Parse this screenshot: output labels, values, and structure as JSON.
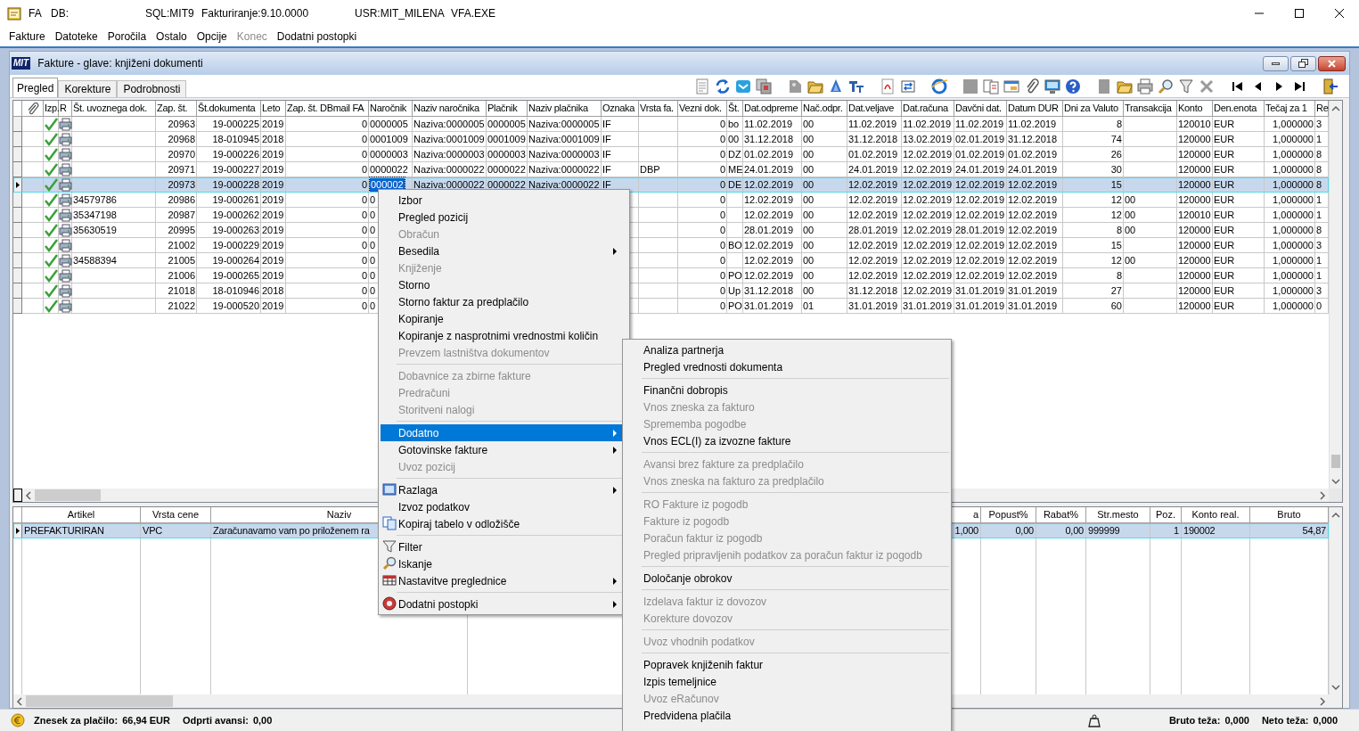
{
  "app_bar": {
    "texts": [
      "FA",
      "DB:",
      "SQL:MIT9",
      "Fakturiranje:9.10.0000",
      "USR:MIT_MILENA",
      "VFA.EXE"
    ]
  },
  "menu_bar": [
    {
      "label": "Fakture",
      "disabled": false
    },
    {
      "label": "Datoteke",
      "disabled": false
    },
    {
      "label": "Poročila",
      "disabled": false
    },
    {
      "label": "Ostalo",
      "disabled": false
    },
    {
      "label": "Opcije",
      "disabled": false
    },
    {
      "label": "Konec",
      "disabled": true
    },
    {
      "label": "Dodatni postopki",
      "disabled": false
    }
  ],
  "child_window": {
    "logo": "MIT",
    "title": "Fakture - glave: knjiženi dokumenti"
  },
  "tabs": [
    {
      "label": "Pregled",
      "selected": true
    },
    {
      "label": "Korekture",
      "selected": false
    },
    {
      "label": "Podrobnosti",
      "selected": false
    }
  ],
  "table": {
    "columns": [
      "Izp.",
      "R",
      "Št. uvoznega dok.",
      "Zap. št.",
      "Št.dokumenta",
      "Leto",
      "Zap. št. DBmail FA",
      "Naročnik",
      "Naziv naročnika",
      "Plačnik",
      "Naziv plačnika",
      "Oznaka",
      "Vrsta fa.",
      "Vezni dok.",
      "Št.",
      "Dat.odpreme",
      "Nač.odpr.",
      "Dat.veljave",
      "Dat.računa",
      "Davčni dat.",
      "Datum DUR",
      "Dni za Valuto",
      "Transakcija",
      "Konto",
      "Den.enota",
      "Tečaj za 1",
      "Re"
    ],
    "rows": [
      {
        "selected": false,
        "cells": [
          "",
          "",
          "",
          "20963",
          "19-000225",
          "2019",
          "0",
          "0000005",
          "Naziva:0000005",
          "0000005",
          "Naziva:0000005",
          "IF",
          "",
          "0",
          "bo",
          "11.02.2019",
          "00",
          "11.02.2019",
          "11.02.2019",
          "11.02.2019",
          "11.02.2019",
          "8",
          "",
          "120010",
          "EUR",
          "1,000000",
          "3"
        ]
      },
      {
        "selected": false,
        "cells": [
          "",
          "",
          "",
          "20968",
          "18-010945",
          "2018",
          "0",
          "0001009",
          "Naziva:0001009",
          "0001009",
          "Naziva:0001009",
          "IF",
          "",
          "0",
          "00",
          "31.12.2018",
          "00",
          "31.12.2018",
          "13.02.2019",
          "02.01.2019",
          "31.12.2018",
          "74",
          "",
          "120000",
          "EUR",
          "1,000000",
          "1"
        ]
      },
      {
        "selected": false,
        "cells": [
          "",
          "",
          "",
          "20970",
          "19-000226",
          "2019",
          "0",
          "0000003",
          "Naziva:0000003",
          "0000003",
          "Naziva:0000003",
          "IF",
          "",
          "0",
          "DZ",
          "01.02.2019",
          "00",
          "01.02.2019",
          "12.02.2019",
          "01.02.2019",
          "01.02.2019",
          "26",
          "",
          "120000",
          "EUR",
          "1,000000",
          "8"
        ]
      },
      {
        "selected": false,
        "cells": [
          "",
          "",
          "",
          "20971",
          "19-000227",
          "2019",
          "0",
          "0000022",
          "Naziva:0000022",
          "0000022",
          "Naziva:0000022",
          "IF",
          "DBP",
          "0",
          "ME",
          "24.01.2019",
          "00",
          "24.01.2019",
          "12.02.2019",
          "24.01.2019",
          "24.01.2019",
          "30",
          "",
          "120000",
          "EUR",
          "1,000000",
          "8"
        ]
      },
      {
        "selected": true,
        "cells": [
          "",
          "",
          "",
          "20973",
          "19-000228",
          "2019",
          "0",
          {
            "text": "000002",
            "focused": true
          },
          "Naziva:0000022",
          "0000022",
          "Naziva:0000022",
          "IF",
          "",
          "0",
          "DE",
          "12.02.2019",
          "00",
          "12.02.2019",
          "12.02.2019",
          "12.02.2019",
          "12.02.2019",
          "15",
          "",
          "120000",
          "EUR",
          "1,000000",
          "8"
        ]
      },
      {
        "selected": false,
        "cells": [
          "",
          "",
          "34579786",
          "20986",
          "19-000261",
          "2019",
          "0",
          "0",
          "",
          "",
          "",
          "",
          "",
          "0",
          "",
          "12.02.2019",
          "00",
          "12.02.2019",
          "12.02.2019",
          "12.02.2019",
          "12.02.2019",
          "12",
          "00",
          "120000",
          "EUR",
          "1,000000",
          "1"
        ]
      },
      {
        "selected": false,
        "cells": [
          "",
          "",
          "35347198",
          "20987",
          "19-000262",
          "2019",
          "0",
          "0",
          "",
          "",
          "",
          "",
          "",
          "0",
          "",
          "12.02.2019",
          "00",
          "12.02.2019",
          "12.02.2019",
          "12.02.2019",
          "12.02.2019",
          "12",
          "00",
          "120010",
          "EUR",
          "1,000000",
          "1"
        ]
      },
      {
        "selected": false,
        "cells": [
          "",
          "",
          "35630519",
          "20995",
          "19-000263",
          "2019",
          "0",
          "0",
          "",
          "",
          "",
          "",
          "",
          "0",
          "",
          "28.01.2019",
          "00",
          "28.01.2019",
          "12.02.2019",
          "28.01.2019",
          "12.02.2019",
          "8",
          "00",
          "120000",
          "EUR",
          "1,000000",
          "8"
        ]
      },
      {
        "selected": false,
        "cells": [
          "",
          "",
          "",
          "21002",
          "19-000229",
          "2019",
          "0",
          "0",
          "",
          "",
          "",
          "",
          "",
          "0",
          "BO",
          "12.02.2019",
          "00",
          "12.02.2019",
          "12.02.2019",
          "12.02.2019",
          "12.02.2019",
          "15",
          "",
          "120000",
          "EUR",
          "1,000000",
          "3"
        ]
      },
      {
        "selected": false,
        "cells": [
          "",
          "",
          "34588394",
          "21005",
          "19-000264",
          "2019",
          "0",
          "0",
          "",
          "",
          "",
          "",
          "",
          "0",
          "",
          "12.02.2019",
          "00",
          "12.02.2019",
          "12.02.2019",
          "12.02.2019",
          "12.02.2019",
          "12",
          "00",
          "120000",
          "EUR",
          "1,000000",
          "1"
        ]
      },
      {
        "selected": false,
        "cells": [
          "",
          "",
          "",
          "21006",
          "19-000265",
          "2019",
          "0",
          "0",
          "",
          "",
          "",
          "",
          "",
          "0",
          "PO",
          "12.02.2019",
          "00",
          "12.02.2019",
          "12.02.2019",
          "12.02.2019",
          "12.02.2019",
          "8",
          "",
          "120000",
          "EUR",
          "1,000000",
          "1"
        ]
      },
      {
        "selected": false,
        "cells": [
          "",
          "",
          "",
          "21018",
          "18-010946",
          "2018",
          "0",
          "0",
          "",
          "",
          "",
          "",
          "",
          "0",
          "Up",
          "31.12.2018",
          "00",
          "31.12.2018",
          "12.02.2019",
          "31.01.2019",
          "31.01.2019",
          "27",
          "",
          "120000",
          "EUR",
          "1,000000",
          "3"
        ]
      },
      {
        "selected": false,
        "cells": [
          "",
          "",
          "",
          "21022",
          "19-000520",
          "2019",
          "0",
          "0",
          "",
          "",
          "",
          "",
          "",
          "0",
          "PO",
          "31.01.2019",
          "01",
          "31.01.2019",
          "31.01.2019",
          "31.01.2019",
          "31.01.2019",
          "60",
          "",
          "120000",
          "EUR",
          "1,000000",
          "0"
        ]
      }
    ]
  },
  "detail_table": {
    "columns": [
      "Artikel",
      "Vrsta cene",
      "Naziv",
      "a",
      "Popust%",
      "Rabat%",
      "Str.mesto",
      "Poz.",
      "Konto real.",
      "Bruto"
    ],
    "rows": [
      {
        "selected": true,
        "cells": [
          "PREFAKTURIRAN",
          "VPC",
          "Zaračunavamo vam po priloženem ra",
          "1,000",
          "0,00",
          "0,00",
          "999999",
          "1",
          "190002",
          "54,87"
        ]
      }
    ]
  },
  "context_menu": {
    "items": [
      {
        "kind": "item",
        "label": "Izbor",
        "disabled": false,
        "has_submenu": false,
        "highlighted": false
      },
      {
        "kind": "item",
        "label": "Pregled pozicij",
        "disabled": false,
        "has_submenu": false,
        "highlighted": false
      },
      {
        "kind": "item",
        "label": "Obračun",
        "disabled": true,
        "has_submenu": false,
        "highlighted": false
      },
      {
        "kind": "item",
        "label": "Besedila",
        "disabled": false,
        "has_submenu": true,
        "highlighted": false
      },
      {
        "kind": "item",
        "label": "Knjiženje",
        "disabled": true,
        "has_submenu": false,
        "highlighted": false
      },
      {
        "kind": "item",
        "label": "Storno",
        "disabled": false,
        "has_submenu": false,
        "highlighted": false
      },
      {
        "kind": "item",
        "label": "Storno faktur za predplačilo",
        "disabled": false,
        "has_submenu": false,
        "highlighted": false
      },
      {
        "kind": "item",
        "label": "Kopiranje",
        "disabled": false,
        "has_submenu": false,
        "highlighted": false
      },
      {
        "kind": "item",
        "label": "Kopiranje z nasprotnimi vrednostmi količin",
        "disabled": false,
        "has_submenu": false,
        "highlighted": false
      },
      {
        "kind": "item",
        "label": "Prevzem lastništva dokumentov",
        "disabled": true,
        "has_submenu": false,
        "highlighted": false
      },
      {
        "kind": "separator"
      },
      {
        "kind": "item",
        "label": "Dobavnice za zbirne fakture",
        "disabled": true,
        "has_submenu": false,
        "highlighted": false
      },
      {
        "kind": "item",
        "label": "Predračuni",
        "disabled": true,
        "has_submenu": false,
        "highlighted": false
      },
      {
        "kind": "item",
        "label": "Storitveni nalogi",
        "disabled": true,
        "has_submenu": false,
        "highlighted": false
      },
      {
        "kind": "separator"
      },
      {
        "kind": "item",
        "label": "Dodatno",
        "disabled": false,
        "has_submenu": true,
        "highlighted": true
      },
      {
        "kind": "item",
        "label": "Gotovinske fakture",
        "disabled": false,
        "has_submenu": true,
        "highlighted": false
      },
      {
        "kind": "item",
        "label": "Uvoz pozicij",
        "disabled": true,
        "has_submenu": false,
        "highlighted": false
      },
      {
        "kind": "separator"
      },
      {
        "kind": "item",
        "label": "Razlaga",
        "disabled": false,
        "has_submenu": true,
        "highlighted": false
      },
      {
        "kind": "item",
        "label": "Izvoz podatkov",
        "disabled": false,
        "has_submenu": false,
        "highlighted": false
      },
      {
        "kind": "item",
        "label": "Kopiraj tabelo v odložišče",
        "disabled": false,
        "has_submenu": false,
        "highlighted": false
      },
      {
        "kind": "separator"
      },
      {
        "kind": "item",
        "label": "Filter",
        "disabled": false,
        "has_submenu": false,
        "highlighted": false
      },
      {
        "kind": "item",
        "label": "Iskanje",
        "disabled": false,
        "has_submenu": false,
        "highlighted": false
      },
      {
        "kind": "item",
        "label": "Nastavitve preglednice",
        "disabled": false,
        "has_submenu": true,
        "highlighted": false
      },
      {
        "kind": "separator"
      },
      {
        "kind": "item",
        "label": "Dodatni postopki",
        "disabled": false,
        "has_submenu": true,
        "highlighted": false
      }
    ]
  },
  "submenu": {
    "items": [
      {
        "kind": "item",
        "label": "Analiza partnerja",
        "disabled": false
      },
      {
        "kind": "item",
        "label": "Pregled vrednosti dokumenta",
        "disabled": false
      },
      {
        "kind": "separator"
      },
      {
        "kind": "item",
        "label": "Finančni dobropis",
        "disabled": false
      },
      {
        "kind": "item",
        "label": "Vnos zneska za fakturo",
        "disabled": true
      },
      {
        "kind": "item",
        "label": "Sprememba pogodbe",
        "disabled": true
      },
      {
        "kind": "item",
        "label": "Vnos ECL(I) za izvozne fakture",
        "disabled": false
      },
      {
        "kind": "separator"
      },
      {
        "kind": "item",
        "label": "Avansi brez fakture za predplačilo",
        "disabled": true
      },
      {
        "kind": "item",
        "label": "Vnos zneska na fakturo za predplačilo",
        "disabled": true
      },
      {
        "kind": "separator"
      },
      {
        "kind": "item",
        "label": "RO Fakture iz pogodb",
        "disabled": true
      },
      {
        "kind": "item",
        "label": "Fakture iz pogodb",
        "disabled": true
      },
      {
        "kind": "item",
        "label": "Poračun faktur iz pogodb",
        "disabled": true
      },
      {
        "kind": "item",
        "label": "Pregled pripravljenih podatkov za poračun faktur iz pogodb",
        "disabled": true
      },
      {
        "kind": "separator"
      },
      {
        "kind": "item",
        "label": "Določanje obrokov",
        "disabled": false
      },
      {
        "kind": "separator"
      },
      {
        "kind": "item",
        "label": "Izdelava faktur iz dovozov",
        "disabled": true
      },
      {
        "kind": "item",
        "label": "Korekture dovozov",
        "disabled": true
      },
      {
        "kind": "separator"
      },
      {
        "kind": "item",
        "label": "Uvoz vhodnih podatkov",
        "disabled": true
      },
      {
        "kind": "separator"
      },
      {
        "kind": "item",
        "label": "Popravek knjiženih faktur",
        "disabled": false
      },
      {
        "kind": "item",
        "label": "Izpis temeljnice",
        "disabled": false
      },
      {
        "kind": "item",
        "label": "Uvoz eRačunov",
        "disabled": true
      },
      {
        "kind": "item",
        "label": "Predvidena plačila",
        "disabled": false
      }
    ]
  },
  "status_bar": {
    "left": [
      {
        "label": "Znesek za plačilo:",
        "value": "66,94 EUR"
      },
      {
        "label": "Odprti avansi:",
        "value": "0,00"
      }
    ],
    "right": [
      {
        "label": "Bruto teža:",
        "value": "0,000"
      },
      {
        "label": "Neto teža:",
        "value": "0,000"
      }
    ]
  }
}
